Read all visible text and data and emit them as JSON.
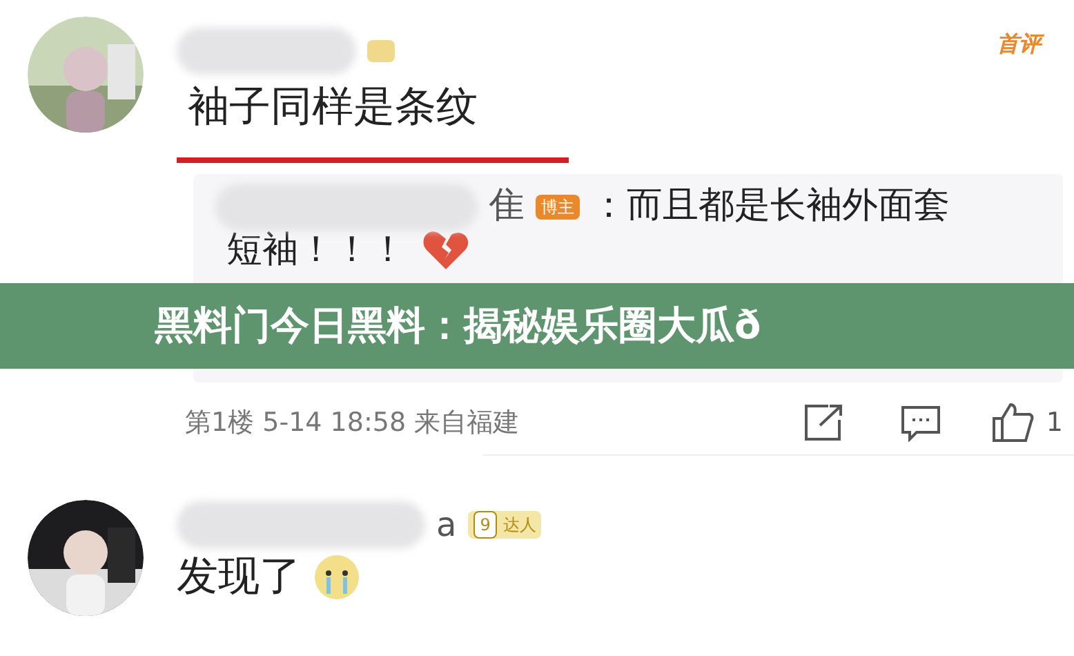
{
  "comments": [
    {
      "badge": "首评",
      "text": "袖子同样是条纹",
      "reply": {
        "name_tail": "隹",
        "role_badge": "博主",
        "text": "：而且都是长袖外面套",
        "text_line2": "短袖！！！"
      },
      "floor": "第1楼",
      "date": "5-14 18:58",
      "location": "来自福建",
      "like_count": "1"
    },
    {
      "name_tail": "a",
      "level": "9",
      "level_badge": "达人",
      "text": "发现了"
    }
  ],
  "banner": {
    "title": "黑料门今日黑料：揭秘娱乐圈大瓜ð"
  }
}
